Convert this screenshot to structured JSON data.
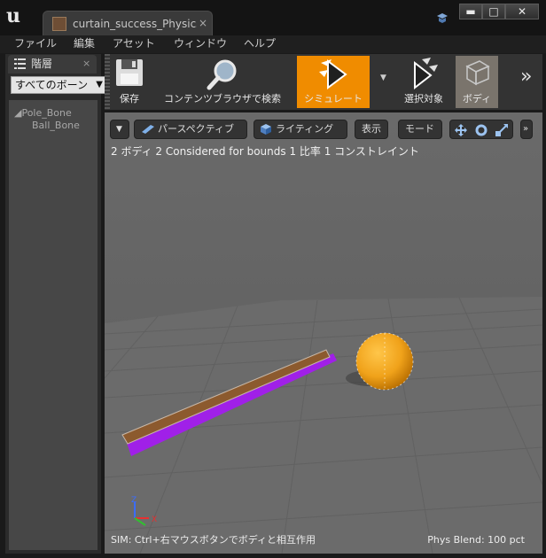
{
  "titlebar": {
    "tab_title": "curtain_success_PhysicsA",
    "tab_close": "×",
    "minimize": "▬",
    "maximize": "□",
    "close": "✕"
  },
  "menu": {
    "items": [
      "ファイル",
      "編集",
      "アセット",
      "ウィンドウ",
      "ヘルプ"
    ]
  },
  "hierarchy": {
    "tab_label": "階層",
    "tab_close": "×",
    "filter_value": "すべてのボーン",
    "bones": [
      "◢Pole_Bone",
      "Ball_Bone"
    ]
  },
  "toolbar": {
    "save": "保存",
    "browse": "コンテンツブラウザで検索",
    "simulate": "シミュレート",
    "selected": "選択対象",
    "body": "ボディ",
    "more": "»",
    "accent": "#f08c00"
  },
  "viewport": {
    "perspective": "パースペクティブ",
    "lighting": "ライティング",
    "show": "表示",
    "mode": "モード",
    "more": "»",
    "stats": "2 ボディ 2 Considered for bounds 1 比率 1 コンストレイント",
    "sim_hint": "SIM: Ctrl+右マウスボタンでボディと相互作用",
    "phys_blend": "Phys Blend: 100 pct",
    "axis_x": "X",
    "axis_z": "Z"
  }
}
